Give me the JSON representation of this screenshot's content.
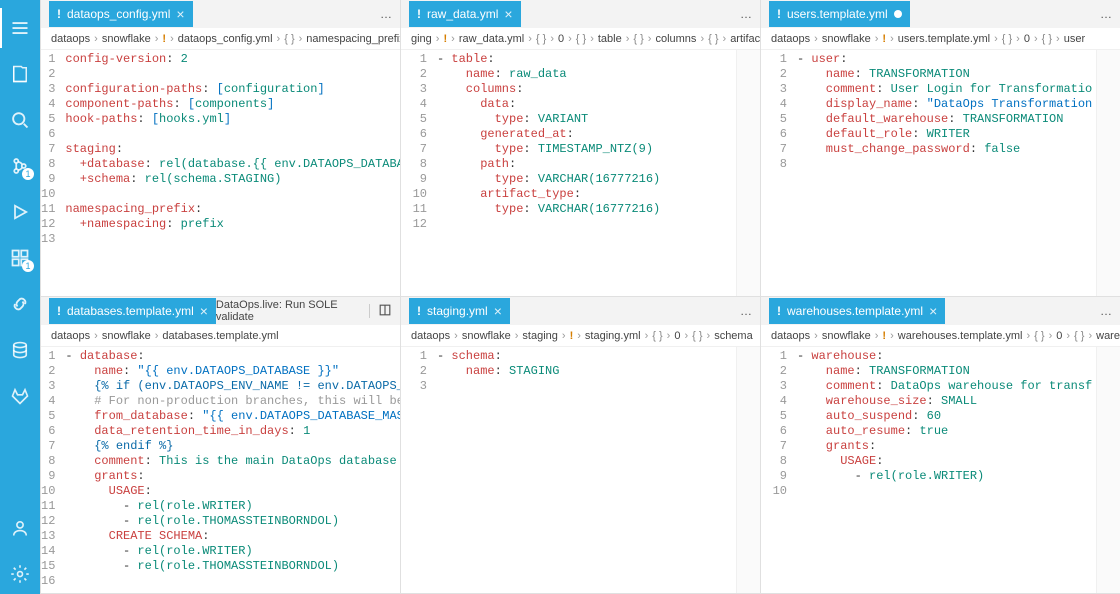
{
  "activity": {
    "badge_scm": "1",
    "badge_ext": "1"
  },
  "groups": [
    {
      "tab": {
        "name": "dataops_config.yml",
        "modified": false,
        "icon": "!"
      },
      "overflow": "…",
      "breadcrumbs": [
        "dataops",
        "snowflake",
        "!",
        "dataops_config.yml",
        "{ }",
        "namespacing_prefix"
      ],
      "lines": [
        [
          [
            "config-version",
            "k-key"
          ],
          [
            ": ",
            ""
          ],
          [
            "2",
            "k-num"
          ]
        ],
        [
          [
            "",
            ""
          ]
        ],
        [
          [
            "configuration-paths",
            "k-key"
          ],
          [
            ": ",
            ""
          ],
          [
            "[",
            "k-b"
          ],
          [
            "configuration",
            "k-val"
          ],
          [
            "]",
            "k-b"
          ]
        ],
        [
          [
            "component-paths",
            "k-key"
          ],
          [
            ": ",
            ""
          ],
          [
            "[",
            "k-b"
          ],
          [
            "components",
            "k-val"
          ],
          [
            "]",
            "k-b"
          ]
        ],
        [
          [
            "hook-paths",
            "k-key"
          ],
          [
            ": ",
            ""
          ],
          [
            "[",
            "k-b"
          ],
          [
            "hooks.yml",
            "k-val"
          ],
          [
            "]",
            "k-b"
          ]
        ],
        [
          [
            "",
            ""
          ]
        ],
        [
          [
            "staging",
            "k-key"
          ],
          [
            ":",
            ""
          ]
        ],
        [
          [
            "  +database",
            "k-key"
          ],
          [
            ": ",
            ""
          ],
          [
            "rel(database.{{ env.DATAOPS_DATABASE }})",
            "k-val"
          ]
        ],
        [
          [
            "  +schema",
            "k-key"
          ],
          [
            ": ",
            ""
          ],
          [
            "rel(schema.STAGING)",
            "k-val"
          ]
        ],
        [
          [
            "",
            ""
          ]
        ],
        [
          [
            "namespacing_prefix",
            "k-key"
          ],
          [
            ":",
            ""
          ]
        ],
        [
          [
            "  +namespacing",
            "k-key"
          ],
          [
            ": ",
            ""
          ],
          [
            "prefix",
            "k-val"
          ]
        ],
        [
          [
            "",
            ""
          ]
        ]
      ]
    },
    {
      "tab": {
        "name": "raw_data.yml",
        "modified": false,
        "icon": "!"
      },
      "overflow": "…",
      "breadcrumbs": [
        "ging",
        "!",
        "raw_data.yml",
        "{ }",
        "0",
        "{ }",
        "table",
        "{ }",
        "columns",
        "{ }",
        "artifact_type"
      ],
      "lines": [
        [
          [
            "- ",
            ""
          ],
          [
            "table",
            "k-key"
          ],
          [
            ":",
            ""
          ]
        ],
        [
          [
            "    name",
            "k-key"
          ],
          [
            ": ",
            ""
          ],
          [
            "raw_data",
            "k-val"
          ]
        ],
        [
          [
            "    columns",
            "k-key"
          ],
          [
            ":",
            ""
          ]
        ],
        [
          [
            "      data",
            "k-key"
          ],
          [
            ":",
            ""
          ]
        ],
        [
          [
            "        type",
            "k-key"
          ],
          [
            ": ",
            ""
          ],
          [
            "VARIANT",
            "k-val"
          ]
        ],
        [
          [
            "      generated_at",
            "k-key"
          ],
          [
            ":",
            ""
          ]
        ],
        [
          [
            "        type",
            "k-key"
          ],
          [
            ": ",
            ""
          ],
          [
            "TIMESTAMP_NTZ(9)",
            "k-val"
          ]
        ],
        [
          [
            "      path",
            "k-key"
          ],
          [
            ":",
            ""
          ]
        ],
        [
          [
            "        type",
            "k-key"
          ],
          [
            ": ",
            ""
          ],
          [
            "VARCHAR(16777216)",
            "k-val"
          ]
        ],
        [
          [
            "      artifact_type",
            "k-key"
          ],
          [
            ":",
            ""
          ]
        ],
        [
          [
            "        type",
            "k-key"
          ],
          [
            ": ",
            ""
          ],
          [
            "VARCHAR(16777216)",
            "k-val"
          ]
        ],
        [
          [
            "",
            ""
          ]
        ]
      ]
    },
    {
      "tab": {
        "name": "users.template.yml",
        "modified": true,
        "icon": "!"
      },
      "overflow": "…",
      "breadcrumbs": [
        "dataops",
        "snowflake",
        "!",
        "users.template.yml",
        "{ }",
        "0",
        "{ }",
        "user"
      ],
      "lines": [
        [
          [
            "- ",
            ""
          ],
          [
            "user",
            "k-key"
          ],
          [
            ":",
            ""
          ]
        ],
        [
          [
            "    name",
            "k-key"
          ],
          [
            ": ",
            ""
          ],
          [
            "TRANSFORMATION",
            "k-val"
          ]
        ],
        [
          [
            "    comment",
            "k-key"
          ],
          [
            ": ",
            ""
          ],
          [
            "User Login for Transformatio",
            "k-val"
          ]
        ],
        [
          [
            "    display_name",
            "k-key"
          ],
          [
            ": ",
            ""
          ],
          [
            "\"DataOps Transformation",
            "k-str2"
          ]
        ],
        [
          [
            "    default_warehouse",
            "k-key"
          ],
          [
            ": ",
            ""
          ],
          [
            "TRANSFORMATION",
            "k-val"
          ]
        ],
        [
          [
            "    default_role",
            "k-key"
          ],
          [
            ": ",
            ""
          ],
          [
            "WRITER",
            "k-val"
          ]
        ],
        [
          [
            "    must_change_password",
            "k-key"
          ],
          [
            ": ",
            ""
          ],
          [
            "false",
            "k-val"
          ]
        ],
        [
          [
            "",
            ""
          ]
        ]
      ]
    },
    {
      "tab": {
        "name": "databases.template.yml",
        "modified": false,
        "icon": "!"
      },
      "right_cmd": "DataOps.live: Run SOLE validate",
      "breadcrumbs": [
        "dataops",
        "snowflake",
        "databases.template.yml"
      ],
      "lines": [
        [
          [
            "- ",
            ""
          ],
          [
            "database",
            "k-key"
          ],
          [
            ":",
            ""
          ]
        ],
        [
          [
            "    name",
            "k-key"
          ],
          [
            ": ",
            ""
          ],
          [
            "\"{{ env.DATAOPS_DATABASE }}\"",
            "k-str2"
          ]
        ],
        [
          [
            "    {% if (env.DATAOPS_ENV_NAME != env.DATAOPS_ENV_NAME_PR",
            "k-str"
          ]
        ],
        [
          [
            "    # For non-production branches, this will be a clone of",
            "k-cm"
          ]
        ],
        [
          [
            "    from_database",
            "k-key"
          ],
          [
            ": ",
            ""
          ],
          [
            "\"{{ env.DATAOPS_DATABASE_MASTER }}\"",
            "k-str2"
          ]
        ],
        [
          [
            "    data_retention_time_in_days",
            "k-key"
          ],
          [
            ": ",
            ""
          ],
          [
            "1",
            "k-num"
          ]
        ],
        [
          [
            "    {% endif %}",
            "k-str"
          ]
        ],
        [
          [
            "    comment",
            "k-key"
          ],
          [
            ": ",
            ""
          ],
          [
            "This is the main DataOps database for environ",
            "k-val"
          ]
        ],
        [
          [
            "    grants",
            "k-key"
          ],
          [
            ":",
            ""
          ]
        ],
        [
          [
            "      USAGE",
            "k-key"
          ],
          [
            ":",
            ""
          ]
        ],
        [
          [
            "        - ",
            ""
          ],
          [
            "rel(role.WRITER)",
            "k-val"
          ]
        ],
        [
          [
            "        - ",
            ""
          ],
          [
            "rel(role.THOMASSTEINBORNDOL)",
            "k-val"
          ]
        ],
        [
          [
            "      CREATE SCHEMA",
            "k-key"
          ],
          [
            ":",
            ""
          ]
        ],
        [
          [
            "        - ",
            ""
          ],
          [
            "rel(role.WRITER)",
            "k-val"
          ]
        ],
        [
          [
            "        - ",
            ""
          ],
          [
            "rel(role.THOMASSTEINBORNDOL)",
            "k-val"
          ]
        ],
        [
          [
            "",
            ""
          ]
        ]
      ]
    },
    {
      "tab": {
        "name": "staging.yml",
        "modified": false,
        "icon": "!"
      },
      "overflow": "…",
      "breadcrumbs": [
        "dataops",
        "snowflake",
        "staging",
        "!",
        "staging.yml",
        "{ }",
        "0",
        "{ }",
        "schema"
      ],
      "lines": [
        [
          [
            "- ",
            ""
          ],
          [
            "schema",
            "k-key"
          ],
          [
            ":",
            ""
          ]
        ],
        [
          [
            "    name",
            "k-key"
          ],
          [
            ": ",
            ""
          ],
          [
            "STAGING",
            "k-val"
          ]
        ],
        [
          [
            "",
            ""
          ]
        ]
      ]
    },
    {
      "tab": {
        "name": "warehouses.template.yml",
        "modified": false,
        "icon": "!"
      },
      "overflow": "…",
      "breadcrumbs": [
        "dataops",
        "snowflake",
        "!",
        "warehouses.template.yml",
        "{ }",
        "0",
        "{ }",
        "wareho"
      ],
      "lines": [
        [
          [
            "- ",
            ""
          ],
          [
            "warehouse",
            "k-key"
          ],
          [
            ":",
            ""
          ]
        ],
        [
          [
            "    name",
            "k-key"
          ],
          [
            ": ",
            ""
          ],
          [
            "TRANSFORMATION",
            "k-val"
          ]
        ],
        [
          [
            "    comment",
            "k-key"
          ],
          [
            ": ",
            ""
          ],
          [
            "DataOps warehouse for transf",
            "k-val"
          ]
        ],
        [
          [
            "    warehouse_size",
            "k-key"
          ],
          [
            ": ",
            ""
          ],
          [
            "SMALL",
            "k-val"
          ]
        ],
        [
          [
            "    auto_suspend",
            "k-key"
          ],
          [
            ": ",
            ""
          ],
          [
            "60",
            "k-num"
          ]
        ],
        [
          [
            "    auto_resume",
            "k-key"
          ],
          [
            ": ",
            ""
          ],
          [
            "true",
            "k-val"
          ]
        ],
        [
          [
            "    grants",
            "k-key"
          ],
          [
            ":",
            ""
          ]
        ],
        [
          [
            "      USAGE",
            "k-key"
          ],
          [
            ":",
            ""
          ]
        ],
        [
          [
            "        - ",
            ""
          ],
          [
            "rel(role.WRITER)",
            "k-val"
          ]
        ],
        [
          [
            "",
            ""
          ]
        ]
      ]
    }
  ]
}
